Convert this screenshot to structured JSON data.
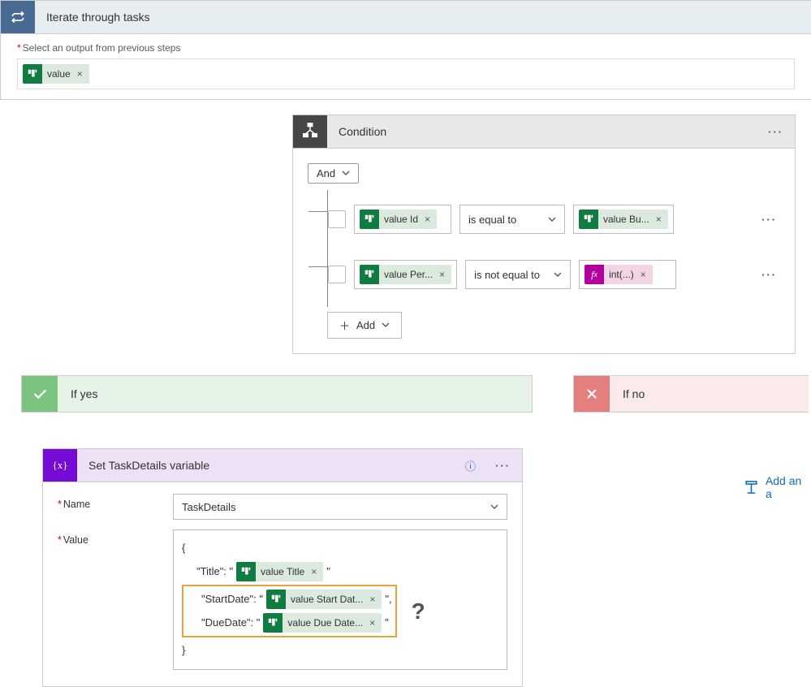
{
  "loop": {
    "title": "Iterate through tasks",
    "outputLabel": "Select an output from previous steps",
    "outputToken": "value"
  },
  "condition": {
    "title": "Condition",
    "groupOperator": "And",
    "rows": [
      {
        "left": "value Id",
        "op": "is equal to",
        "right": "value Bu...",
        "rightKind": "green"
      },
      {
        "left": "value Per...",
        "op": "is not equal to",
        "right": "int(...)",
        "rightKind": "pink"
      }
    ],
    "addLabel": "Add"
  },
  "branches": {
    "yes": "If yes",
    "no": "If no",
    "addAction": "Add an a"
  },
  "setVar": {
    "title": "Set TaskDetails variable",
    "nameLabel": "Name",
    "nameValue": "TaskDetails",
    "valueLabel": "Value",
    "json": {
      "open": "{",
      "titleKey": "\"Title\": \"",
      "titleTok": "value Title",
      "startKey": "\"StartDate\": \"",
      "startTok": "value Start Dat...",
      "dueKey": "\"DueDate\": \"",
      "dueTok": "value Due Date...",
      "close": "}",
      "tail": "\"",
      "tailComma": "\","
    },
    "question": "?"
  }
}
